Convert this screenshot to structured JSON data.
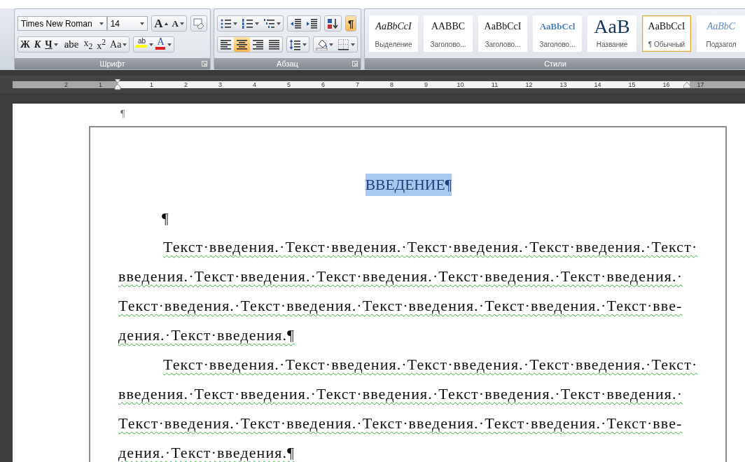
{
  "font_group": {
    "label": "Шрифт",
    "font_name": "Times New Roman",
    "font_size": "14",
    "grow_label": "A",
    "shrink_label": "A",
    "format_buttons": [
      {
        "kind": "bold",
        "label": "Ж",
        "menu": false
      },
      {
        "kind": "italic",
        "label": "К",
        "menu": false
      },
      {
        "kind": "underline",
        "label": "Ч",
        "menu": true
      },
      {
        "kind": "strike",
        "label": "abe",
        "menu": false
      },
      {
        "kind": "plain",
        "label": "x$_{2}$",
        "menu": false
      },
      {
        "kind": "plain",
        "label": "x$^{2}$",
        "menu": false
      },
      {
        "kind": "plain",
        "label": "Aa",
        "menu": true
      }
    ],
    "highlight_label": "ab",
    "font_color_label": "A"
  },
  "paragraph_group": {
    "label": "Абзац",
    "rows": [
      [
        [
          {
            "kind": "bullets",
            "on": false,
            "menu": true
          },
          {
            "kind": "numbering",
            "on": false,
            "menu": true
          },
          {
            "kind": "multilevel",
            "on": false,
            "menu": true
          }
        ],
        [
          {
            "kind": "outdent",
            "on": false,
            "menu": false
          },
          {
            "kind": "indent",
            "on": false,
            "menu": false
          }
        ],
        [
          {
            "kind": "sort",
            "on": false,
            "menu": false
          }
        ],
        [
          {
            "kind": "pilcrow",
            "label": "¶",
            "on": true,
            "menu": false
          }
        ]
      ],
      [
        [
          {
            "kind": "align-left",
            "on": false,
            "menu": false
          },
          {
            "kind": "align-center",
            "on": true,
            "menu": false
          },
          {
            "kind": "align-right",
            "on": false,
            "menu": false
          },
          {
            "kind": "justify",
            "on": false,
            "menu": false
          }
        ],
        [
          {
            "kind": "line-spacing",
            "on": false,
            "menu": true
          }
        ],
        [
          {
            "kind": "shading",
            "on": false,
            "menu": true
          },
          {
            "kind": "borders",
            "on": false,
            "menu": true
          }
        ]
      ]
    ]
  },
  "styles_group": {
    "label": "Стили",
    "items": [
      {
        "kind": "emphasis",
        "sample": "AaBbCcI",
        "name": "Выделение",
        "selected": false
      },
      {
        "kind": "caps",
        "sample": "AABBC",
        "name": "Заголово...",
        "selected": false
      },
      {
        "kind": "plain",
        "sample": "AaBbCcI",
        "name": "Заголово...",
        "selected": false
      },
      {
        "kind": "heading",
        "sample": "AaBbCcl",
        "name": "Заголово...",
        "selected": false
      },
      {
        "kind": "title",
        "sample": "AaB",
        "name": "Название",
        "selected": false
      },
      {
        "kind": "plain",
        "sample": "AaBbCcI",
        "name": "¶ Обычный",
        "selected": true
      },
      {
        "kind": "subtitle",
        "sample": "AaBbC",
        "name": "Подзагол",
        "selected": false
      }
    ]
  },
  "ruler": {
    "left_numbers": [
      "2",
      "1"
    ],
    "right_numbers": [
      "1",
      "2",
      "3",
      "4",
      "5",
      "6",
      "7",
      "8",
      "9",
      "10",
      "11",
      "12",
      "13",
      "14",
      "15",
      "16",
      "17"
    ]
  },
  "document": {
    "top_mark": "¶",
    "heading": {
      "text": "ВВЕДЕНИЕ¶",
      "selected": true
    },
    "empty_paragraph": "¶",
    "paragraphs": [
      {
        "lines": [
          "Текст·введения.·Текст·введения.·Текст·введения.·Текст·введения.·Текст·",
          "введения.·Текст·введения.·Текст·введения.·Текст·введения.·Текст·введения.·",
          "Текст·введения.·Текст·введения.·Текст·введения.·Текст·введения.·Текст·вве-",
          "дения.·Текст·введения.¶"
        ]
      },
      {
        "lines": [
          "Текст·введения.·Текст·введения.·Текст·введения.·Текст·введения.·Текст·",
          "введения.·Текст·введения.·Текст·введения.·Текст·введения.·Текст·введения.·",
          "Текст·введения.·Текст·введения.·Текст·введения.·Текст·введения.·Текст·вве-",
          "дения.·Текст·введения.¶"
        ]
      }
    ]
  }
}
